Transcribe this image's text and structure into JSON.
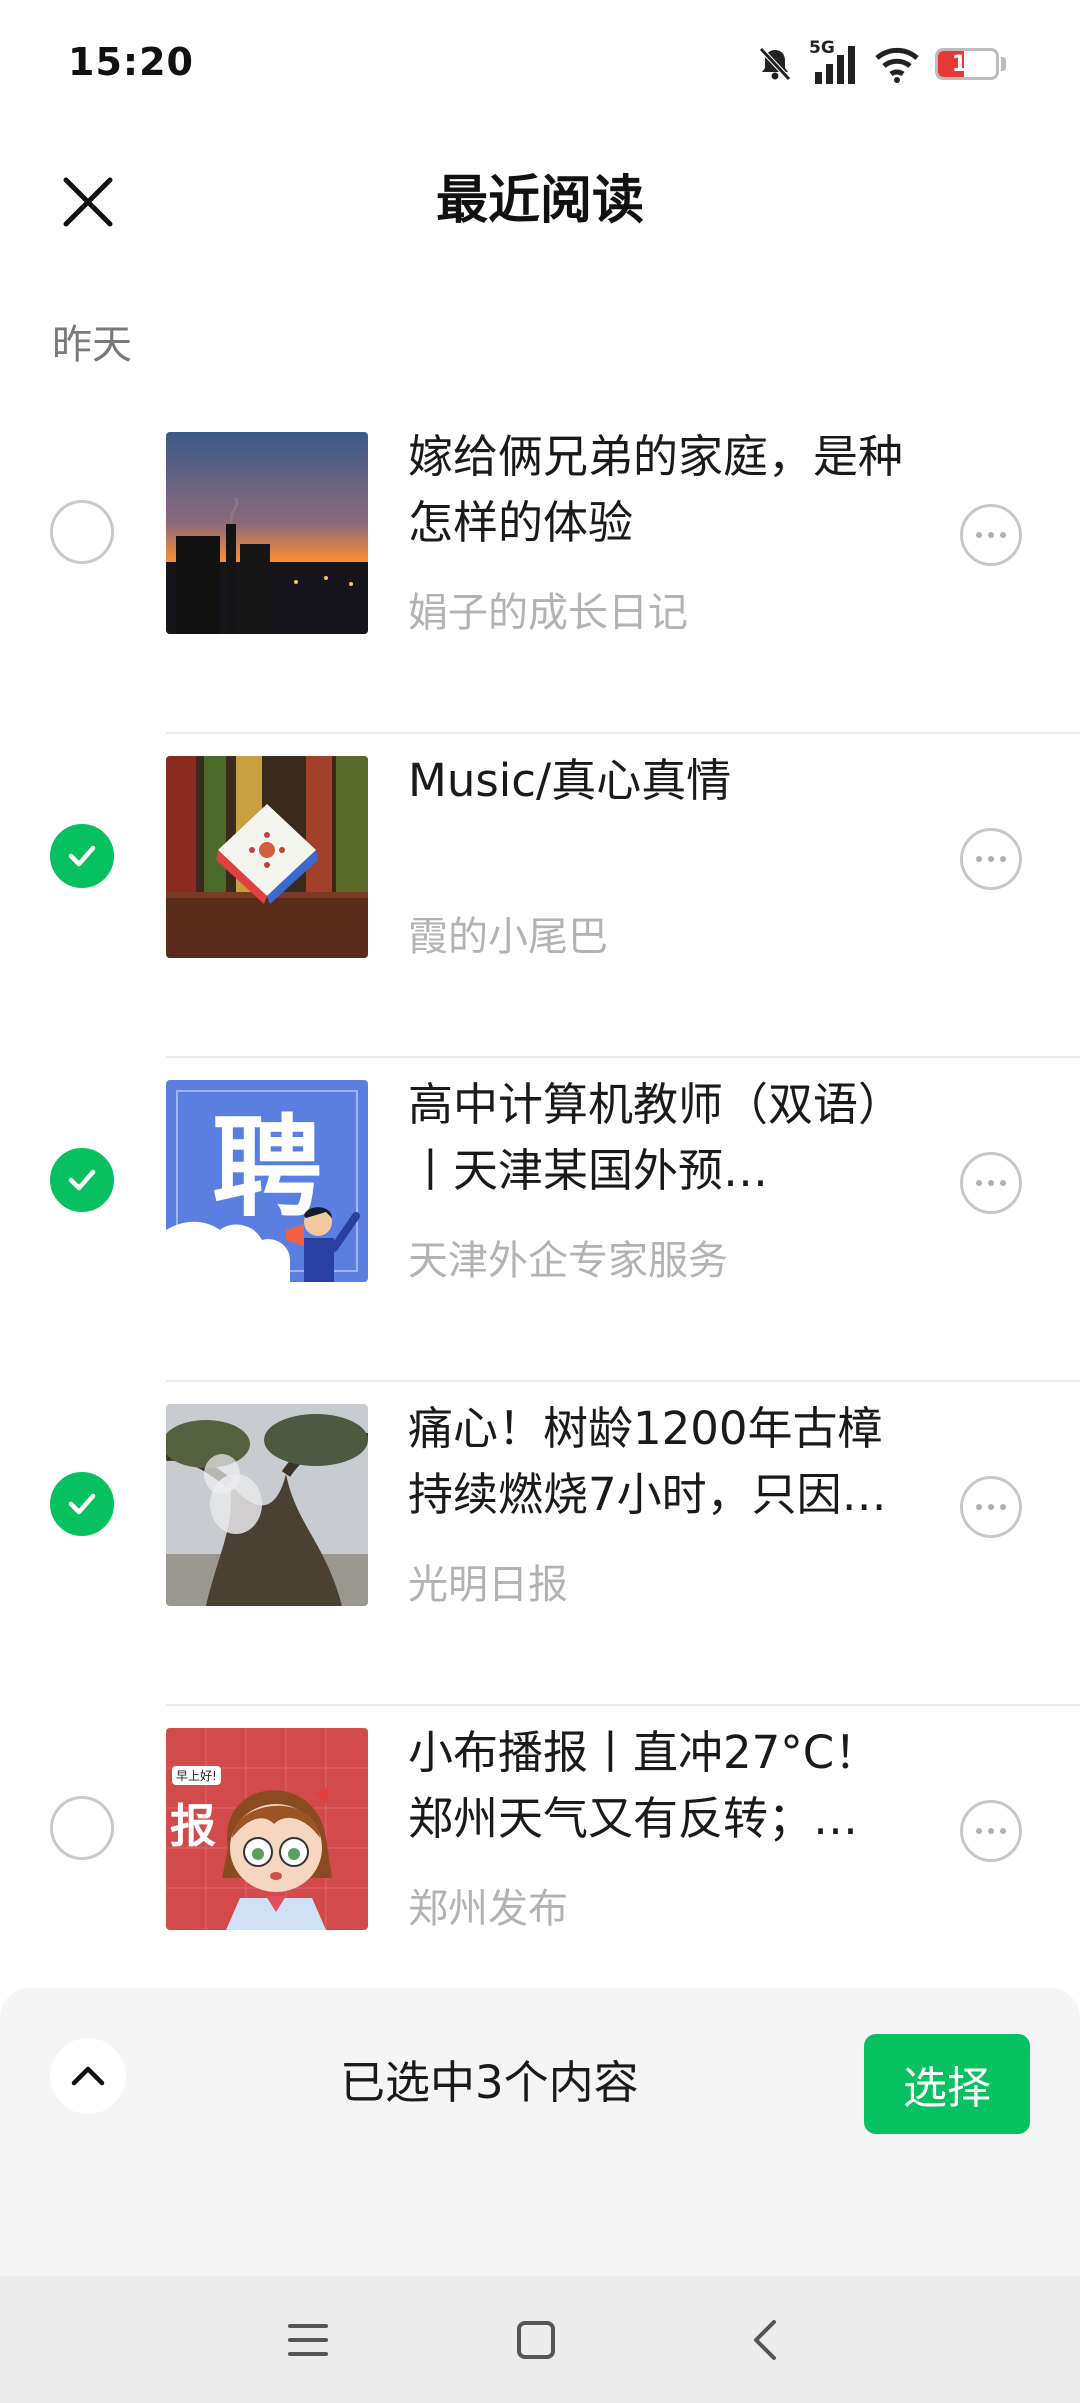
{
  "status_bar": {
    "time": "15:20",
    "network": "5G",
    "battery": "17",
    "battery_level": 0.17,
    "battery_color": "#e53935"
  },
  "header": {
    "title": "最近阅读"
  },
  "section": {
    "label": "昨天"
  },
  "items": [
    {
      "title": "嫁给俩兄弟的家庭，是种怎样的体验",
      "source": "娟子的成长日记",
      "checked": false,
      "thumb": "sunset-factory"
    },
    {
      "title": "Music/真心真情",
      "source": "霞的小尾巴",
      "checked": true,
      "thumb": "rubik-cube"
    },
    {
      "title": "高中计算机教师（双语）丨天津某国外预…",
      "source": "天津外企专家服务",
      "checked": true,
      "thumb": "hiring-poster",
      "thumb_text": "聘"
    },
    {
      "title": "痛心！树龄1200年古樟持续燃烧7小时，只因…",
      "source": "光明日报",
      "checked": true,
      "thumb": "old-tree"
    },
    {
      "title": "小布播报丨直冲27°C！郑州天气又有反转；…",
      "source": "郑州发布",
      "checked": false,
      "thumb": "cartoon-report",
      "thumb_tag": "早上好!",
      "thumb_text": "报"
    }
  ],
  "bottom_bar": {
    "selected_text": "已选中3个内容",
    "select_label": "选择"
  },
  "colors": {
    "accent": "#07c160"
  }
}
